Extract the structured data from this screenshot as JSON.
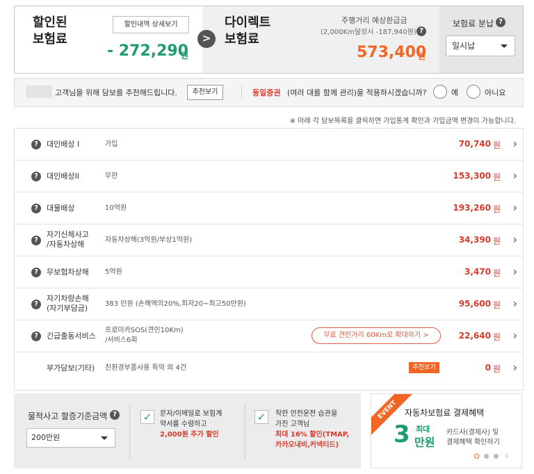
{
  "summary": {
    "discount_title_line1": "할인된",
    "discount_title_line2": "보험료",
    "detail_button": "할인내역 상세보기",
    "discount_value": "- 272,290",
    "discount_unit": "원",
    "arrow": ">",
    "direct_title_line1": "다이렉트",
    "direct_title_line2": "보험료",
    "refund_label": "주행거리 예상환급금",
    "refund_sub": "(2,000Km달성시 -187,940원)",
    "premium_value": "573,400",
    "premium_unit": "원",
    "payment_label": "보험료 분납",
    "payment_selected": "일시납"
  },
  "recommend": {
    "text": "고객님을 위해 담보를 추천해드립니다.",
    "button": "추천보기",
    "question_red": "동일증권",
    "question_rest": "(여러 대를 함께 관리)을 적용하시겠습니까?",
    "yes": "예",
    "no": "아니요"
  },
  "notice": "※ 아래 각 담보목록을 클릭하면 가입통계 확인과 가입금액 변경이 가능합니다.",
  "coverages": [
    {
      "name1": "대인배상 I",
      "name2": "",
      "detail1": "가입",
      "detail2": "",
      "price": "70,740",
      "unit": "원"
    },
    {
      "name1": "대인배상II",
      "name2": "",
      "detail1": "무한",
      "detail2": "",
      "price": "153,300",
      "unit": "원"
    },
    {
      "name1": "대물배상",
      "name2": "",
      "detail1": "10억원",
      "detail2": "",
      "price": "193,260",
      "unit": "원"
    },
    {
      "name1": "자기신체사고",
      "name2": "/자동차상해",
      "detail1": "자동차상해(3억원/부상1억원)",
      "detail2": "",
      "price": "34,390",
      "unit": "원"
    },
    {
      "name1": "무보험차상해",
      "name2": "",
      "detail1": "5억원",
      "detail2": "",
      "price": "3,470",
      "unit": "원"
    },
    {
      "name1": "자기차량손해",
      "name2": "(자기부담금)",
      "detail1": "383 만원 (손해액의20%,최저20~최고50만원)",
      "detail2": "",
      "price": "95,600",
      "unit": "원"
    },
    {
      "name1": "긴급출동서비스",
      "name2": "",
      "detail1": "프로미카SOS(견인10Km)",
      "detail2": "/서비스6회",
      "price": "22,640",
      "unit": "원",
      "pill": "무료 견인거리 60Km로 확대하기 >"
    },
    {
      "name1": "부가담보(기타)",
      "name2": "",
      "detail1": "친환경부품사용 특약 외 4건",
      "detail2": "",
      "price": "0",
      "unit": "원",
      "tag": "추천보기"
    }
  ],
  "bottom": {
    "accident_label": "물적사고 할증기준금액",
    "accident_selected": "200만원",
    "opt1_line1": "문자/이메일로 보험계",
    "opt1_line2": "약서를 수령하고",
    "opt1_red": "2,000원 추가 할인",
    "opt2_line1": "착한 안전운전 습관을",
    "opt2_line2": "가진 고객님",
    "opt2_red1": "최대 16% 할인(TMAP,",
    "opt2_red2": "카카오내비,커넥티드)",
    "check": "✓"
  },
  "event": {
    "ribbon": "EVENT",
    "title": "자동차보험료 결제혜택",
    "big": "3",
    "small1": "최대",
    "small2": "만원",
    "desc1": "카드사(결제사) 및",
    "desc2": "결제혜택 확인하기",
    "pause": "II"
  },
  "icons": {
    "help": "?",
    "chevron": "›"
  },
  "colors": {
    "green": "#1f9c6c",
    "orange": "#f26522",
    "red": "#d73a2b"
  }
}
